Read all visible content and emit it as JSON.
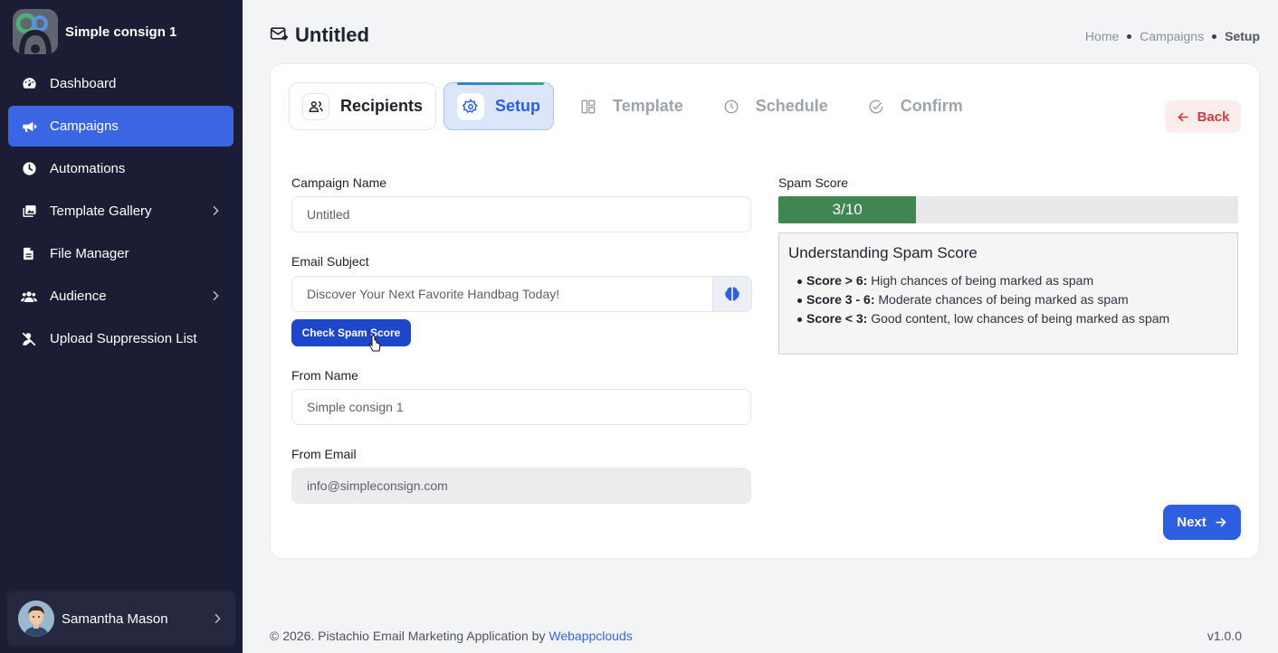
{
  "brand": {
    "name": "Simple consign 1"
  },
  "sidebar": {
    "items": [
      {
        "label": "Dashboard",
        "icon": "dashboard-icon"
      },
      {
        "label": "Campaigns",
        "icon": "megaphone-icon",
        "active": true
      },
      {
        "label": "Automations",
        "icon": "clock-icon"
      },
      {
        "label": "Template Gallery",
        "icon": "gallery-icon",
        "has_submenu": true
      },
      {
        "label": "File Manager",
        "icon": "file-icon"
      },
      {
        "label": "Audience",
        "icon": "users-icon",
        "has_submenu": true
      },
      {
        "label": "Upload Suppression List",
        "icon": "user-block-icon"
      }
    ],
    "user": {
      "name": "Samantha Mason"
    }
  },
  "header": {
    "title": "Untitled",
    "breadcrumb": {
      "home": "Home",
      "campaigns": "Campaigns",
      "current": "Setup"
    }
  },
  "steps": [
    {
      "label": "Recipients",
      "state": "done"
    },
    {
      "label": "Setup",
      "state": "active"
    },
    {
      "label": "Template",
      "state": "pending"
    },
    {
      "label": "Schedule",
      "state": "pending"
    },
    {
      "label": "Confirm",
      "state": "pending"
    }
  ],
  "back_label": "Back",
  "form": {
    "campaign_name": {
      "label": "Campaign Name",
      "value": "Untitled"
    },
    "email_subject": {
      "label": "Email Subject",
      "value": "Discover Your Next Favorite Handbag Today!"
    },
    "check_spam_label": "Check Spam Score",
    "from_name": {
      "label": "From Name",
      "value": "Simple consign 1"
    },
    "from_email": {
      "label": "From Email",
      "value": "info@simpleconsign.com"
    }
  },
  "spam": {
    "label": "Spam Score",
    "score_text": "3/10",
    "score": 3,
    "max": 10,
    "info_title": "Understanding Spam Score",
    "rules": [
      {
        "key": "Score > 6:",
        "text": " High chances of being marked as spam"
      },
      {
        "key": "Score 3 - 6:",
        "text": " Moderate chances of being marked as spam"
      },
      {
        "key": "Score < 3:",
        "text": " Good content, low chances of being marked as spam"
      }
    ]
  },
  "next_label": "Next",
  "footer": {
    "text": "© 2026. Pistachio Email Marketing Application by ",
    "link": "Webappclouds",
    "version": "v1.0.0"
  },
  "colors": {
    "accent": "#2d5fe0",
    "sidebar": "#1b1d34",
    "score_fill": "#3f8650",
    "danger": "#d23b3b"
  }
}
